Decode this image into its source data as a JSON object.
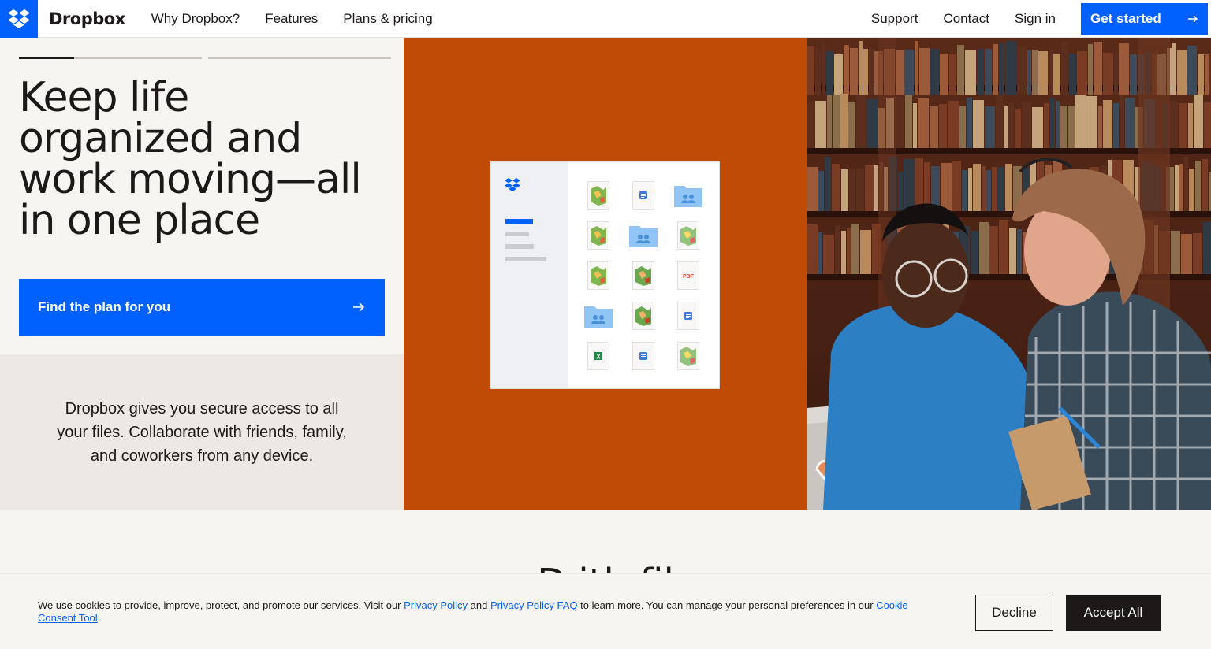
{
  "nav": {
    "brand": "Dropbox",
    "links": [
      "Why Dropbox?",
      "Features",
      "Plans & pricing"
    ],
    "right_links": [
      "Support",
      "Contact",
      "Sign in"
    ],
    "cta_label": "Get started"
  },
  "hero": {
    "headline": "Keep life organized and work moving—all in one place",
    "cta_label": "Find the plan for you",
    "description": "Dropbox gives you secure access to all your files. Collaborate with friends, family, and coworkers from any device.",
    "slide_progress": [
      0.3,
      0,
      0
    ],
    "file_icons": [
      "map-file-icon",
      "doc-file-icon",
      "shared-folder-icon",
      "map-file-icon",
      "shared-folder-icon",
      "map-file-icon",
      "map-file-icon",
      "map-file-icon",
      "pdf-file-icon",
      "shared-folder-icon",
      "map-file-icon",
      "doc-file-icon",
      "spreadsheet-file-icon",
      "doc-file-icon",
      "map-file-icon"
    ],
    "pdf_label": "PDF",
    "xls_label": "X"
  },
  "lower": {
    "title_partial": "D          ith        fil"
  },
  "cookie": {
    "text_1": "We use cookies to provide, improve, protect, and promote our services. Visit our ",
    "link_privacy": "Privacy Policy",
    "text_2": " and ",
    "link_faq": "Privacy Policy FAQ",
    "text_3": " to learn more. You can manage your personal preferences in our ",
    "link_tool": "Cookie Consent Tool",
    "text_4": ".",
    "decline_label": "Decline",
    "accept_label": "Accept All"
  },
  "colors": {
    "primary_blue": "#0061fe",
    "hero_orange": "#c04b07",
    "ink": "#1e1919"
  }
}
